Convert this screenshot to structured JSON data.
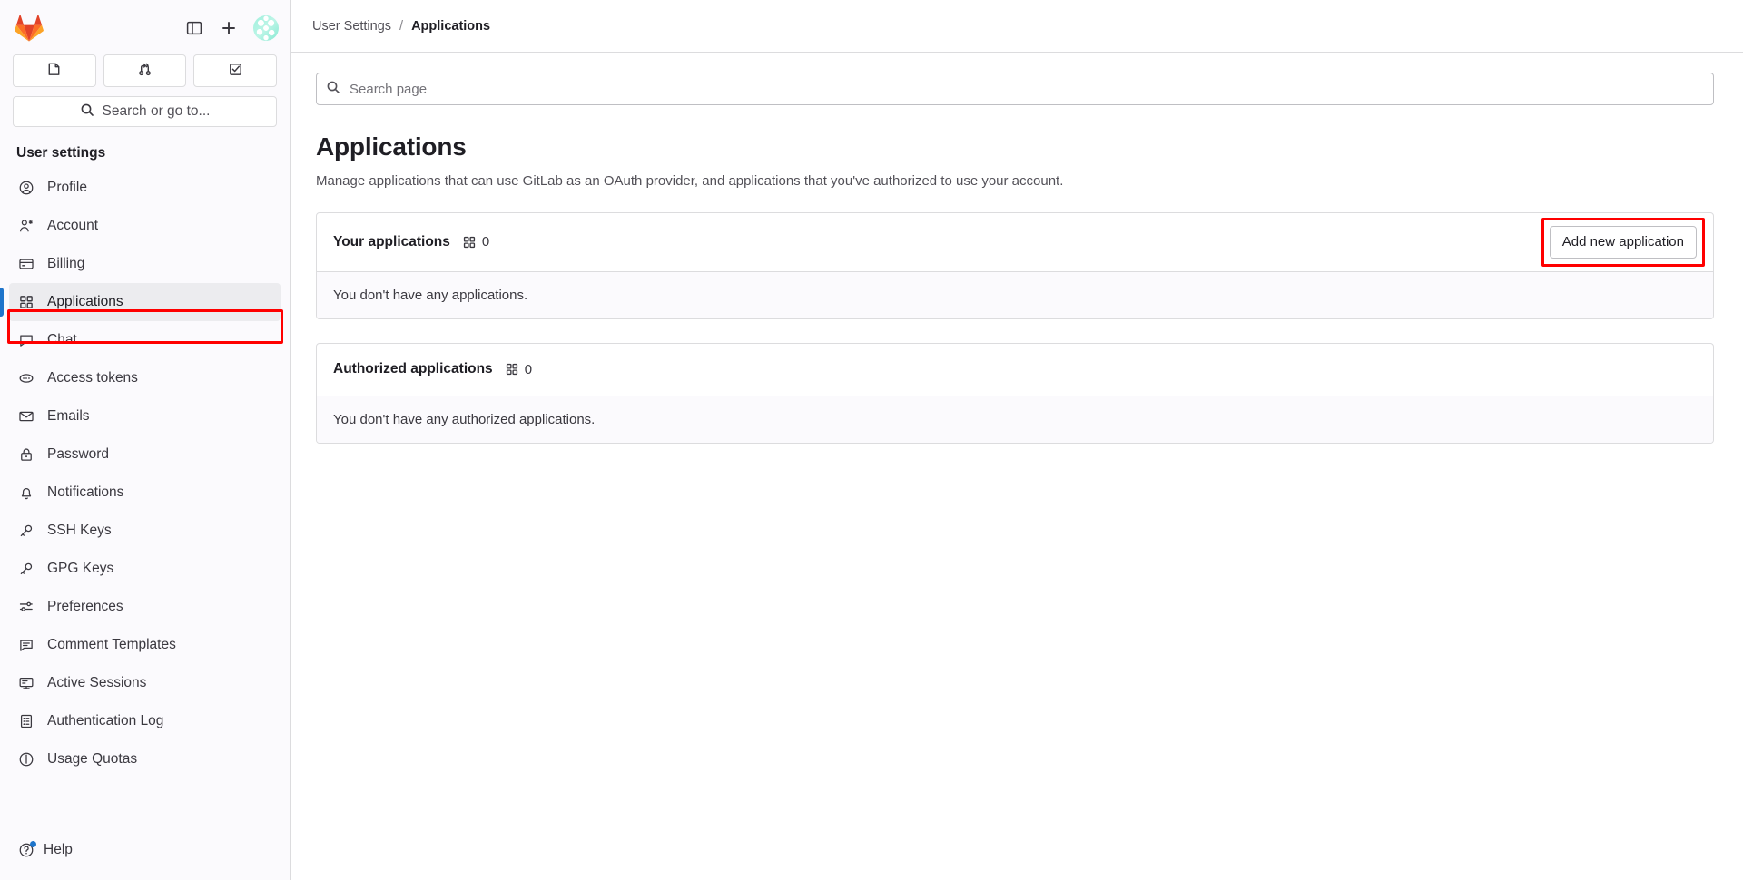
{
  "sidebar": {
    "logo_alt": "GitLab",
    "top_actions": [
      {
        "name": "toggle-sidebar-button",
        "icon": "sidebar-panel-icon"
      },
      {
        "name": "create-new-button",
        "icon": "plus-icon"
      }
    ],
    "avatar_name": "user-avatar",
    "quick_actions": [
      {
        "label": "Issues",
        "icon": "issues-icon"
      },
      {
        "label": "Merge requests",
        "icon": "merge-request-icon"
      },
      {
        "label": "To-Do List",
        "icon": "todo-checkbox-icon"
      }
    ],
    "search": {
      "label": "Search or go to...",
      "icon": "search-icon"
    },
    "section_heading": "User settings",
    "items": [
      {
        "label": "Profile",
        "icon": "profile-icon",
        "active": false
      },
      {
        "label": "Account",
        "icon": "account-icon",
        "active": false
      },
      {
        "label": "Billing",
        "icon": "credit-card-icon",
        "active": false
      },
      {
        "label": "Applications",
        "icon": "applications-icon",
        "active": true
      },
      {
        "label": "Chat",
        "icon": "chat-bubble-icon",
        "active": false
      },
      {
        "label": "Access tokens",
        "icon": "token-icon",
        "active": false
      },
      {
        "label": "Emails",
        "icon": "envelope-icon",
        "active": false
      },
      {
        "label": "Password",
        "icon": "lock-icon",
        "active": false
      },
      {
        "label": "Notifications",
        "icon": "bell-icon",
        "active": false
      },
      {
        "label": "SSH Keys",
        "icon": "key-icon",
        "active": false
      },
      {
        "label": "GPG Keys",
        "icon": "key-icon",
        "active": false
      },
      {
        "label": "Preferences",
        "icon": "preferences-icon",
        "active": false
      },
      {
        "label": "Comment Templates",
        "icon": "comment-lines-icon",
        "active": false
      },
      {
        "label": "Active Sessions",
        "icon": "monitor-icon",
        "active": false
      },
      {
        "label": "Authentication Log",
        "icon": "log-list-icon",
        "active": false
      },
      {
        "label": "Usage Quotas",
        "icon": "quota-gauge-icon",
        "active": false
      }
    ],
    "help": {
      "label": "Help",
      "icon": "question-circle-icon",
      "has_notification_dot": true
    }
  },
  "breadcrumb": {
    "parent": "User Settings",
    "separator": "/",
    "current": "Applications"
  },
  "page_search": {
    "placeholder": "Search page",
    "value": "",
    "icon": "search-icon"
  },
  "main": {
    "title": "Applications",
    "description": "Manage applications that can use GitLab as an OAuth provider, and applications that you've authorized to use your account.",
    "cards": [
      {
        "title": "Your applications",
        "count": "0",
        "count_icon": "applications-icon",
        "action_label": "Add new application",
        "has_action": true,
        "empty_text": "You don't have any applications."
      },
      {
        "title": "Authorized applications",
        "count": "0",
        "count_icon": "applications-icon",
        "action_label": "",
        "has_action": false,
        "empty_text": "You don't have any authorized applications."
      }
    ]
  },
  "annotations": {
    "highlight_color": "#ff0000",
    "targets": [
      "sidebar-item-applications",
      "add-new-application-button"
    ]
  }
}
